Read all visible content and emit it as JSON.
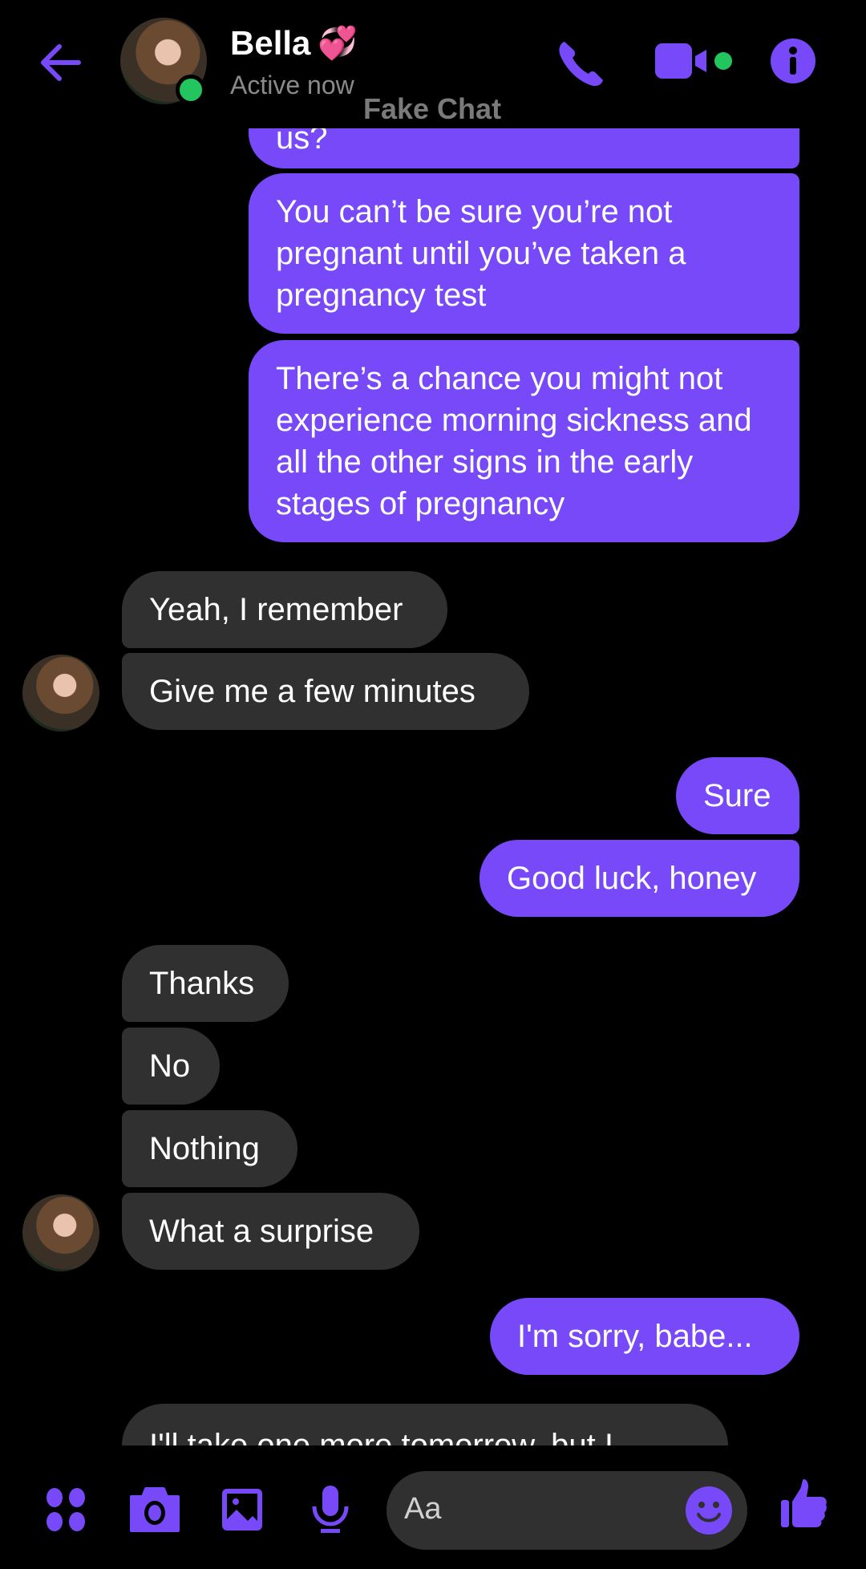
{
  "header": {
    "contact_name": "Bella",
    "name_emoji": "💞",
    "status": "Active now",
    "watermark": "Fake Chat",
    "icons": {
      "back": "back-arrow-icon",
      "call": "phone-icon",
      "video": "video-camera-icon",
      "info": "info-icon"
    }
  },
  "colors": {
    "accent": "#7749f8",
    "incoming_bubble": "#303030",
    "online": "#22c55e",
    "background": "#000000"
  },
  "messages": [
    {
      "sender": "me",
      "text": "us?"
    },
    {
      "sender": "me",
      "text": "You can’t be sure you’re not pregnant until you’ve taken a pregnancy test"
    },
    {
      "sender": "me",
      "text": "There’s a chance you might not experience morning sickness and all the other signs in the early stages of pregnancy"
    },
    {
      "sender": "them",
      "text": "Yeah, I remember"
    },
    {
      "sender": "them",
      "text": "Give me a few minutes"
    },
    {
      "sender": "me",
      "text": "Sure"
    },
    {
      "sender": "me",
      "text": "Good luck, honey"
    },
    {
      "sender": "them",
      "text": "Thanks"
    },
    {
      "sender": "them",
      "text": "No"
    },
    {
      "sender": "them",
      "text": "Nothing"
    },
    {
      "sender": "them",
      "text": "What a surprise"
    },
    {
      "sender": "me",
      "text": "I'm sorry, babe..."
    },
    {
      "sender": "them",
      "text": "I'll take one more tomorrow, but I"
    }
  ],
  "composer": {
    "placeholder": "Aa",
    "icons": [
      "apps-menu-icon",
      "camera-icon",
      "gallery-icon",
      "microphone-icon",
      "emoji-icon",
      "thumbs-up-icon"
    ]
  }
}
